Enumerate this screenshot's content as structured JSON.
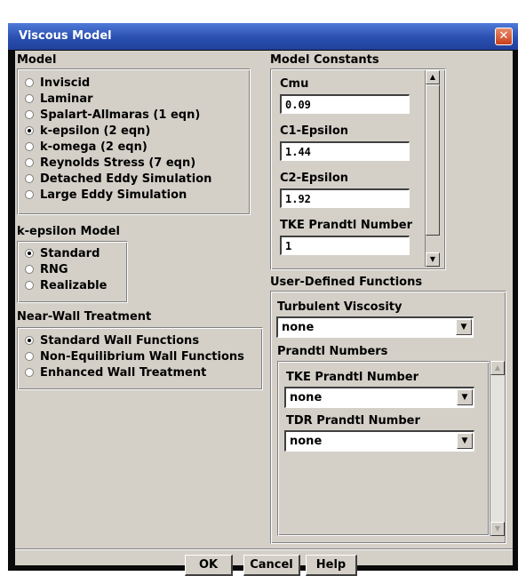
{
  "window": {
    "title": "Viscous Model",
    "close_icon": "close-icon"
  },
  "model": {
    "label": "Model",
    "options": [
      {
        "label": "Inviscid",
        "selected": false
      },
      {
        "label": "Laminar",
        "selected": false
      },
      {
        "label": "Spalart-Allmaras  (1 eqn)",
        "selected": false
      },
      {
        "label": "k-epsilon  (2 eqn)",
        "selected": true
      },
      {
        "label": "k-omega  (2 eqn)",
        "selected": false
      },
      {
        "label": "Reynolds Stress  (7 eqn)",
        "selected": false
      },
      {
        "label": "Detached Eddy Simulation",
        "selected": false
      },
      {
        "label": "Large Eddy Simulation",
        "selected": false
      }
    ]
  },
  "kepsilon_model": {
    "label": "k-epsilon Model",
    "options": [
      {
        "label": "Standard",
        "selected": true
      },
      {
        "label": "RNG",
        "selected": false
      },
      {
        "label": "Realizable",
        "selected": false
      }
    ]
  },
  "near_wall": {
    "label": "Near-Wall Treatment",
    "options": [
      {
        "label": "Standard Wall Functions",
        "selected": true
      },
      {
        "label": "Non-Equilibrium Wall Functions",
        "selected": false
      },
      {
        "label": "Enhanced Wall Treatment",
        "selected": false
      }
    ]
  },
  "model_constants": {
    "label": "Model Constants",
    "fields": [
      {
        "label": "Cmu",
        "value": "0.09"
      },
      {
        "label": "C1-Epsilon",
        "value": "1.44"
      },
      {
        "label": "C2-Epsilon",
        "value": "1.92"
      },
      {
        "label": "TKE Prandtl Number",
        "value": "1"
      }
    ]
  },
  "udf": {
    "label": "User-Defined Functions",
    "turbulent_viscosity": {
      "label": "Turbulent Viscosity",
      "value": "none"
    },
    "prandtl_numbers": {
      "label": "Prandtl Numbers",
      "tke": {
        "label": "TKE Prandtl Number",
        "value": "none"
      },
      "tdr": {
        "label": "TDR Prandtl Number",
        "value": "none"
      }
    }
  },
  "buttons": {
    "ok": "OK",
    "cancel": "Cancel",
    "help": "Help"
  }
}
